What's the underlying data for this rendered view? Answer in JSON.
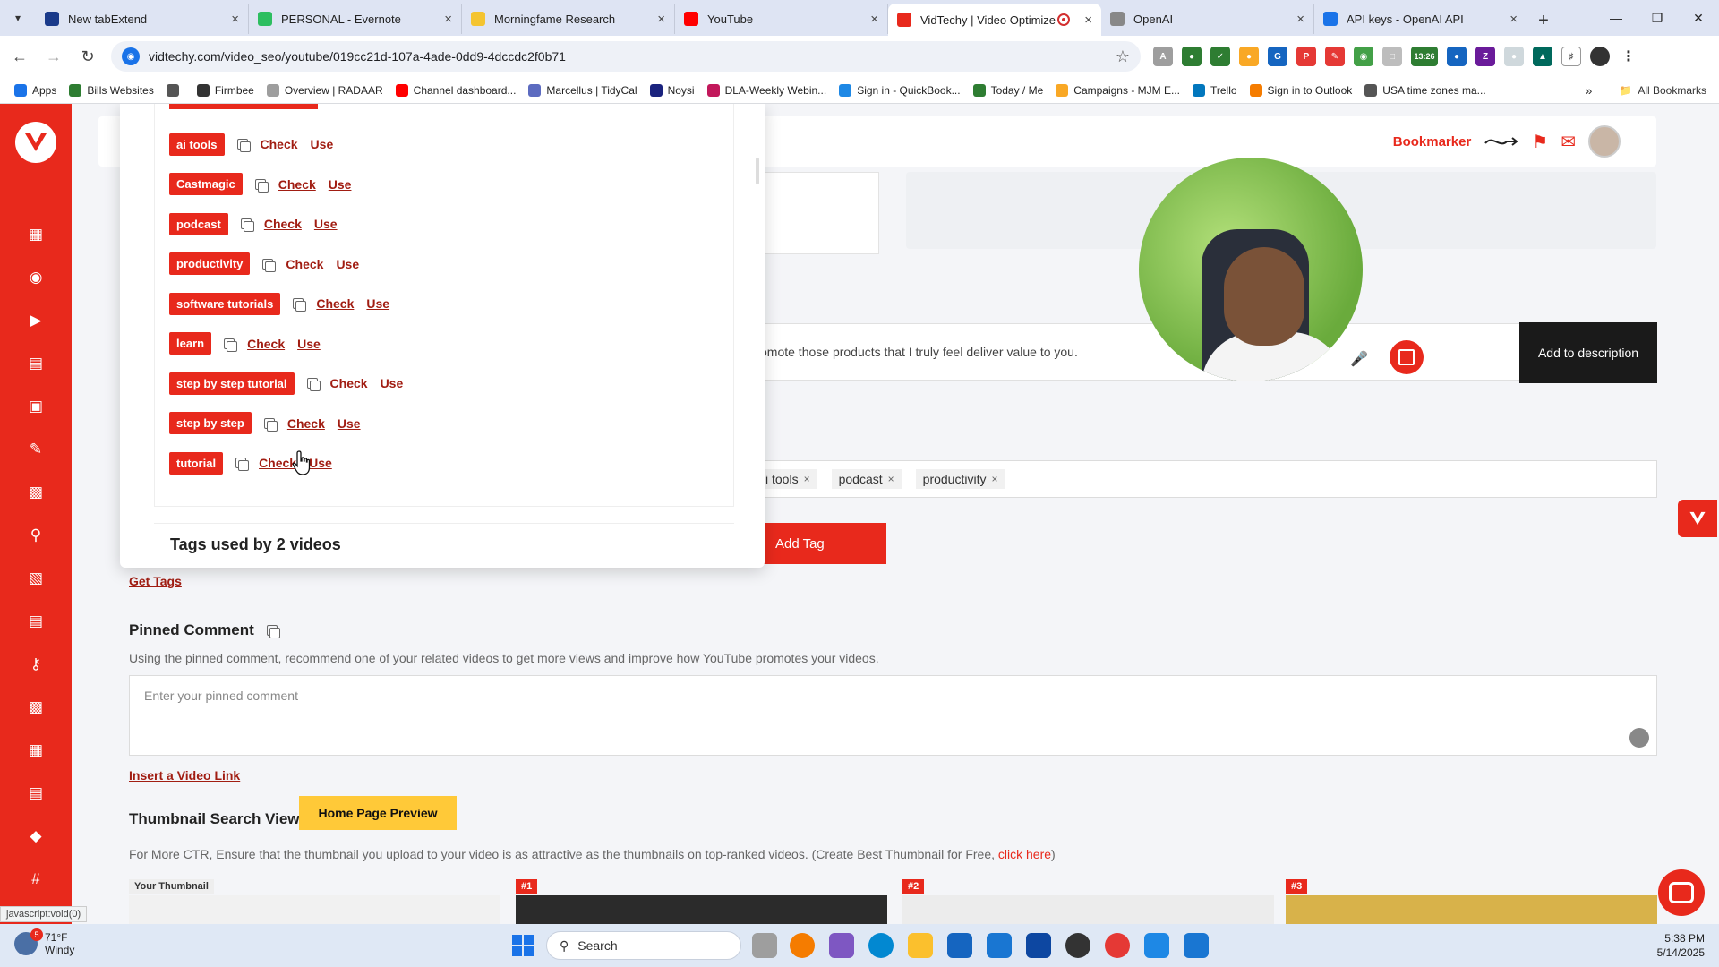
{
  "browser": {
    "tabs": [
      {
        "title": "New tabExtend",
        "color": "#1a3a8a",
        "active": false
      },
      {
        "title": "PERSONAL - Evernote",
        "color": "#2dbe60",
        "active": false
      },
      {
        "title": "Morningfame Research",
        "color": "#f4c430",
        "active": false
      },
      {
        "title": "YouTube",
        "color": "#ff0000",
        "active": false
      },
      {
        "title": "VidTechy | Video Optimize",
        "color": "#e8291c",
        "active": true
      },
      {
        "title": "OpenAI",
        "color": "#888888",
        "active": false
      },
      {
        "title": "API keys - OpenAI API",
        "color": "#1a73e8",
        "active": false
      }
    ],
    "url": "vidtechy.com/video_seo/youtube/019cc21d-107a-4ade-0dd9-4dccdc2f0b71",
    "bookmarks": [
      {
        "label": "Apps",
        "color": "#1a73e8"
      },
      {
        "label": "Bills Websites",
        "color": "#2e7d32"
      },
      {
        "label": "",
        "color": "#555555"
      },
      {
        "label": "Firmbee",
        "color": "#333333"
      },
      {
        "label": "Overview | RADAAR",
        "color": "#9e9e9e"
      },
      {
        "label": "Channel dashboard...",
        "color": "#ff0000"
      },
      {
        "label": "Marcellus | TidyCal",
        "color": "#5c6bc0"
      },
      {
        "label": "Noysi",
        "color": "#1a237e"
      },
      {
        "label": "DLA-Weekly Webin...",
        "color": "#c2185b"
      },
      {
        "label": "Sign in - QuickBook...",
        "color": "#1e88e5"
      },
      {
        "label": "Today / Me",
        "color": "#2e7d32"
      },
      {
        "label": "Campaigns - MJM E...",
        "color": "#f9a825"
      },
      {
        "label": "Trello",
        "color": "#0277bd"
      },
      {
        "label": "Sign in to Outlook",
        "color": "#f57c00"
      },
      {
        "label": "USA time zones ma...",
        "color": "#555555"
      }
    ],
    "all_bookmarks": "All Bookmarks",
    "extension_badge": "13:26"
  },
  "header": {
    "bookmarker_label": "Bookmarker"
  },
  "description": {
    "text": "omote those products that I truly feel deliver value to you.",
    "add_button": "Add to description"
  },
  "tags_field": {
    "chips": [
      {
        "label": "i tools"
      },
      {
        "label": "podcast"
      },
      {
        "label": "productivity"
      }
    ],
    "add_button": "Add Tag"
  },
  "dropdown": {
    "check_label": "Check",
    "use_label": "Use",
    "tags": [
      {
        "label": "ai tools"
      },
      {
        "label": "Castmagic"
      },
      {
        "label": "podcast"
      },
      {
        "label": "productivity"
      },
      {
        "label": "software tutorials"
      },
      {
        "label": "learn"
      },
      {
        "label": "step by step tutorial"
      },
      {
        "label": "step by step"
      },
      {
        "label": "tutorial"
      }
    ],
    "footer": "Tags used by 2 videos"
  },
  "get_tags": "Get Tags",
  "pinned": {
    "title": "Pinned Comment",
    "help": "Using the pinned comment, recommend one of your related videos to get more views and improve how YouTube promotes your videos.",
    "placeholder": "Enter your pinned comment",
    "insert_link": "Insert a Video Link"
  },
  "thumbnail": {
    "title": "Thumbnail Search View",
    "home_preview": "Home Page Preview",
    "ctr_text": "For More CTR, Ensure that the thumbnail you upload to your video is as attractive as the thumbnails on top-ranked videos. (Create Best Thumbnail for Free, ",
    "click_here": "click here",
    "ctr_close": ")",
    "badges": [
      "Your Thumbnail",
      "#1",
      "#2",
      "#3"
    ]
  },
  "status_url": "javascript:void(0)",
  "taskbar": {
    "weather_temp": "71°F",
    "weather_desc": "Windy",
    "weather_badge": "5",
    "search": "Search",
    "time": "5:38 PM",
    "date": "5/14/2025"
  }
}
